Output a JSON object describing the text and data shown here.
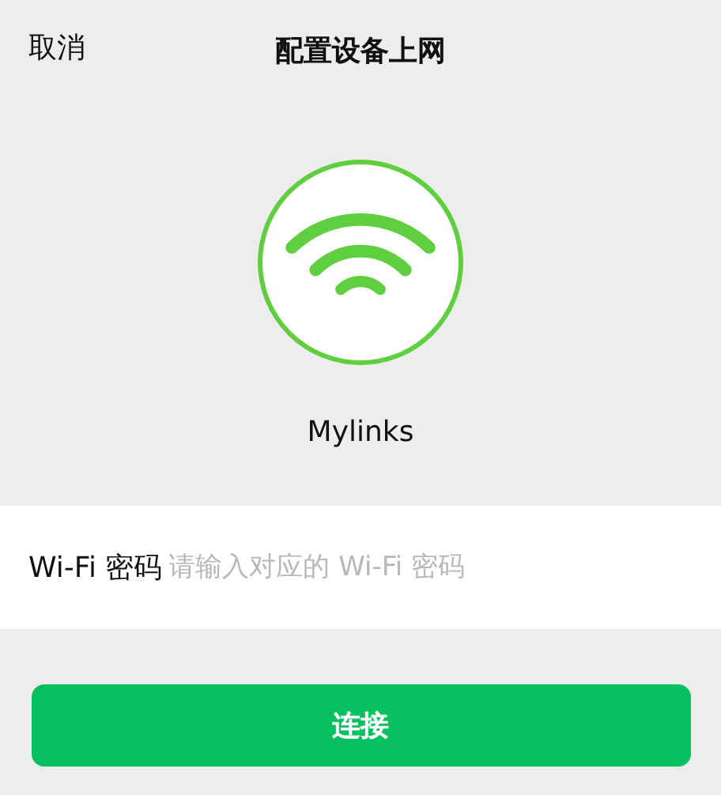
{
  "header": {
    "cancel": "取消",
    "title": "配置设备上网"
  },
  "device": {
    "name": "Mylinks"
  },
  "password": {
    "label": "Wi-Fi 密码",
    "placeholder": "请输入对应的 Wi-Fi 密码"
  },
  "connect_button": "连接"
}
